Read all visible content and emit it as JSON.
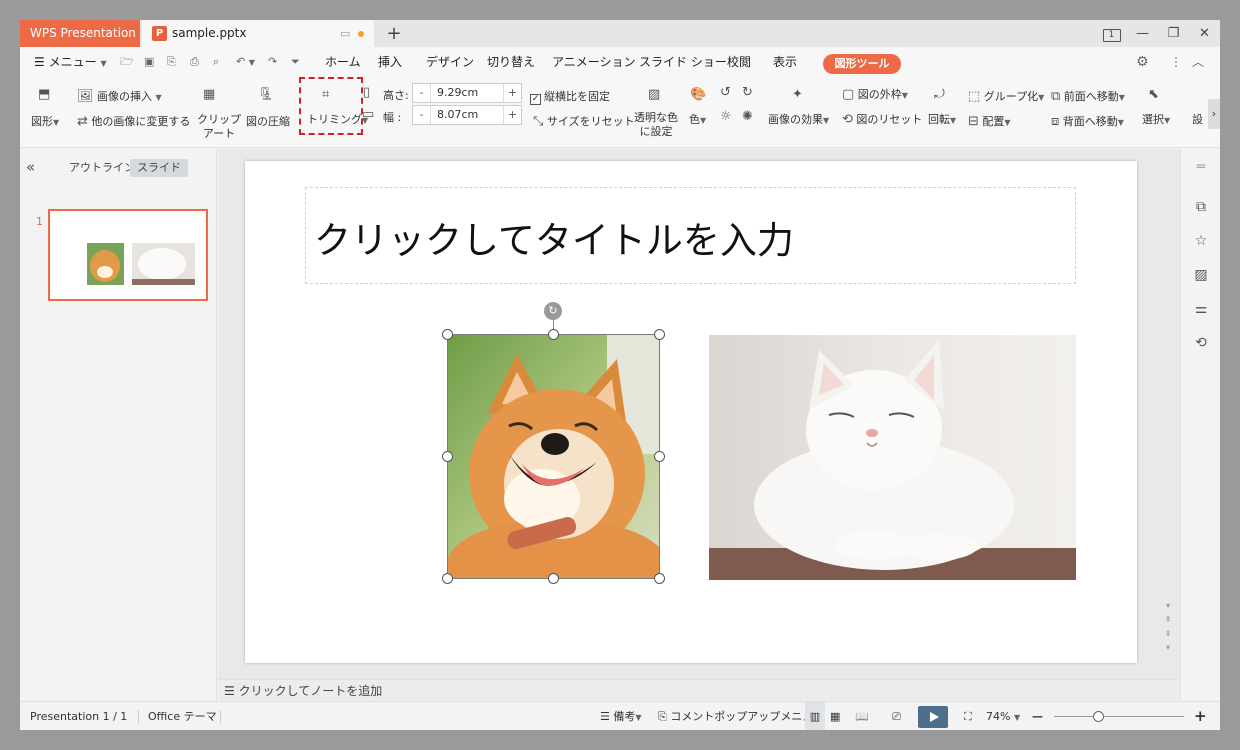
{
  "tabbar": {
    "app_name": "WPS Presentation",
    "doc_name": "sample.pptx",
    "new_tab": "+",
    "page_indicator": "1"
  },
  "menu": {
    "menu_label": "メニュー",
    "tabs": [
      "ホーム",
      "挿入",
      "デザイン",
      "切り替え",
      "アニメーション",
      "スライド ショー",
      "校閲",
      "表示"
    ],
    "active_tab": "図形ツール"
  },
  "ribbon": {
    "shape": "図形",
    "insert_picture": "画像の挿入",
    "change_picture": "他の画像に変更する",
    "clip_art_1": "クリップ",
    "clip_art_2": "アート",
    "compress": "図の圧縮",
    "trim": "トリミング",
    "height_label": "高さ:",
    "height_value": "9.29cm",
    "width_label": "幅 :",
    "width_value": "8.07cm",
    "minus": "-",
    "plus": "+",
    "lock_ratio": "縦横比を固定",
    "reset_size": "サイズをリセット",
    "transparent_1": "透明な色",
    "transparent_2": "に設定",
    "color": "色",
    "effects": "画像の効果",
    "border": "図の外枠",
    "reset_picture": "図のリセット",
    "rotate": "回転",
    "group": "グループ化",
    "align": "配置",
    "bring_forward": "前面へ移動",
    "send_backward": "背面へ移動",
    "select": "選択",
    "settings_cut": "設"
  },
  "leftpane": {
    "outline_tab": "アウトライン",
    "slide_tab": "スライド",
    "slide_number": "1"
  },
  "slide": {
    "title": "クリックしてタイトルを入力"
  },
  "notes": {
    "placeholder": "クリックしてノートを追加"
  },
  "status": {
    "page": "Presentation 1 / 1",
    "theme": "Office テーマ",
    "notes": "備考",
    "comment_popup": "コメントポップアップメニュー",
    "zoom": "74%"
  },
  "colors": {
    "accent": "#ec6a45",
    "trim_highlight": "#d62020"
  }
}
